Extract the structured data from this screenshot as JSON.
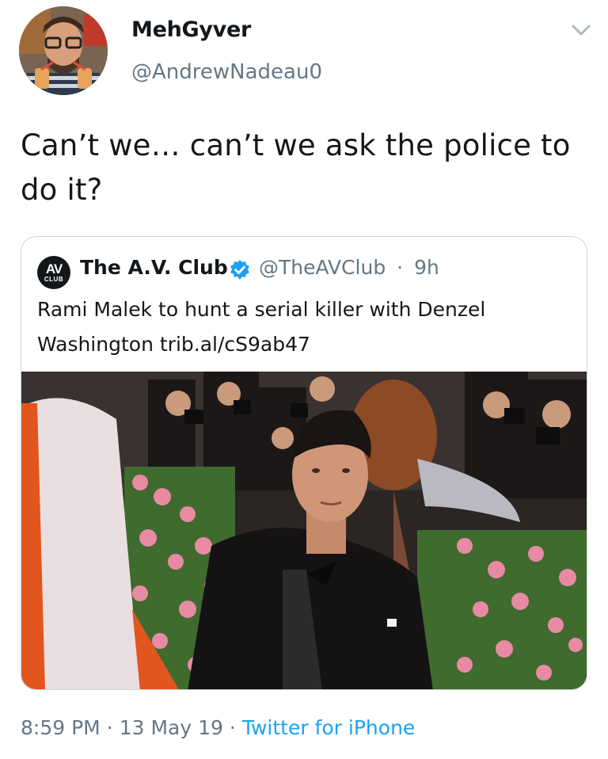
{
  "author": {
    "display_name": "MehGyver",
    "handle": "@AndrewNadeau0"
  },
  "tweet": {
    "text": "Can’t we… can’t we ask the police to do it?",
    "time": "8:59 PM",
    "date": "13 May 19",
    "source": "Twitter for iPhone",
    "separator": "·"
  },
  "quoted_tweet": {
    "avatar_text": "AV",
    "avatar_subtext": "CLUB",
    "display_name": "The A.V. Club",
    "handle": "@TheAVClub",
    "age": "9h",
    "separator": "·",
    "text": "Rami Malek to hunt a serial killer with Denzel Washington trib.al/cS9ab47"
  },
  "icons": {
    "caret": "chevron-down-icon",
    "verified": "verified-badge-icon"
  },
  "colors": {
    "link_blue": "#1da1f2",
    "secondary_text": "#657786",
    "border": "#ccd6dd",
    "background": "#ffffff"
  }
}
